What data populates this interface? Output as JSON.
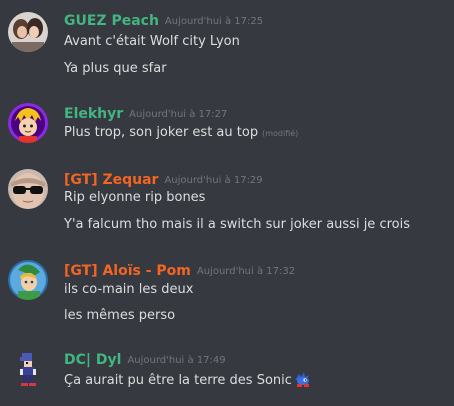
{
  "colors": {
    "background": "#36393f",
    "green_name": "#43b581",
    "orange_name": "#f26522",
    "timestamp": "#72767d",
    "message_text": "#dcddde"
  },
  "messages": [
    {
      "username": "GUEZ Peach",
      "name_color": "green",
      "timestamp": "Aujourd'hui à 17:25",
      "avatar": "two-people-photo-avatar",
      "lines": [
        "Avant c'était Wolf city Lyon",
        "Ya plus que sfar"
      ]
    },
    {
      "username": "Elekhyr",
      "name_color": "green",
      "timestamp": "Aujourd'hui à 17:27",
      "avatar": "blond-cartoon-character-avatar",
      "lines": [
        "Plus trop, son joker est au top"
      ],
      "edited_label": "(modifié)"
    },
    {
      "username": "[GT] Zequar",
      "name_color": "orange",
      "timestamp": "Aujourd'hui à 17:29",
      "avatar": "sunglasses-face-avatar",
      "lines": [
        "Rip elyonne rip bones",
        "Y'a falcum tho mais il a switch sur joker aussi je crois"
      ]
    },
    {
      "username": "[GT] Aloïs - Pom",
      "name_color": "orange",
      "timestamp": "Aujourd'hui à 17:32",
      "avatar": "green-tunic-hero-avatar",
      "lines": [
        "ils co-main les deux",
        "les mêmes perso"
      ]
    },
    {
      "username": "DC| Dyl",
      "name_color": "green",
      "timestamp": "Aujourd'hui à 17:49",
      "avatar": "pixel-sprite-avatar",
      "lines": [
        "Ça aurait pu être la terre des Sonic"
      ],
      "trailing_emoji": "sonic-emoji"
    }
  ]
}
